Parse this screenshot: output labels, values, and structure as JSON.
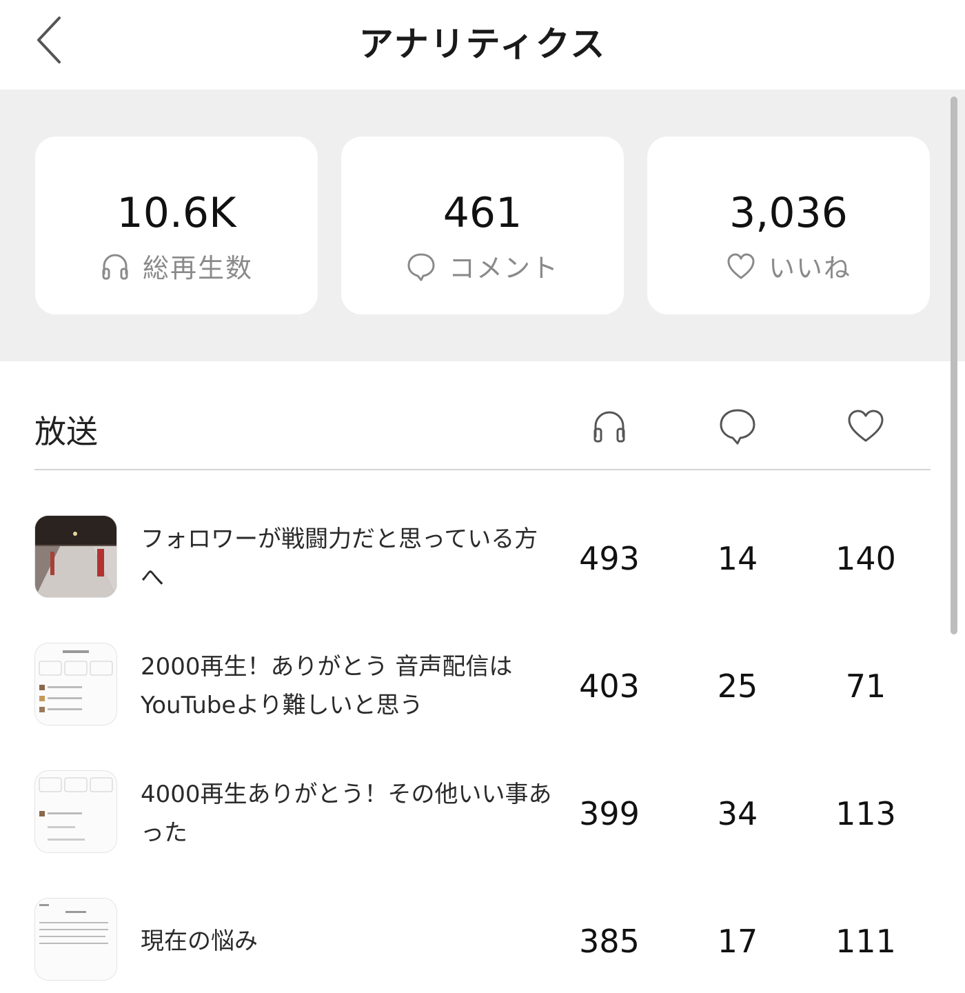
{
  "header": {
    "title": "アナリティクス",
    "back_icon": "chevron-left-icon"
  },
  "summary": [
    {
      "value": "10.6K",
      "label": "総再生数",
      "icon": "headphones-icon"
    },
    {
      "value": "461",
      "label": "コメント",
      "icon": "comment-icon"
    },
    {
      "value": "3,036",
      "label": "いいね",
      "icon": "heart-icon"
    }
  ],
  "episodes": {
    "title": "放送",
    "column_icons": [
      "headphones-icon",
      "comment-icon",
      "heart-icon"
    ],
    "rows": [
      {
        "title": "フォロワーが戦闘力だと思っている方へ",
        "plays": "493",
        "comments": "14",
        "likes": "140"
      },
      {
        "title": "2000再生！ありがとう 音声配信はYouTubeより難しいと思う",
        "plays": "403",
        "comments": "25",
        "likes": "71"
      },
      {
        "title": "4000再生ありがとう！その他いい事あった",
        "plays": "399",
        "comments": "34",
        "likes": "113"
      },
      {
        "title": "現在の悩み",
        "plays": "385",
        "comments": "17",
        "likes": "111"
      }
    ]
  },
  "colors": {
    "summary_bg": "#efefef",
    "card_bg": "#ffffff",
    "label_gray": "#8a8a8a"
  }
}
